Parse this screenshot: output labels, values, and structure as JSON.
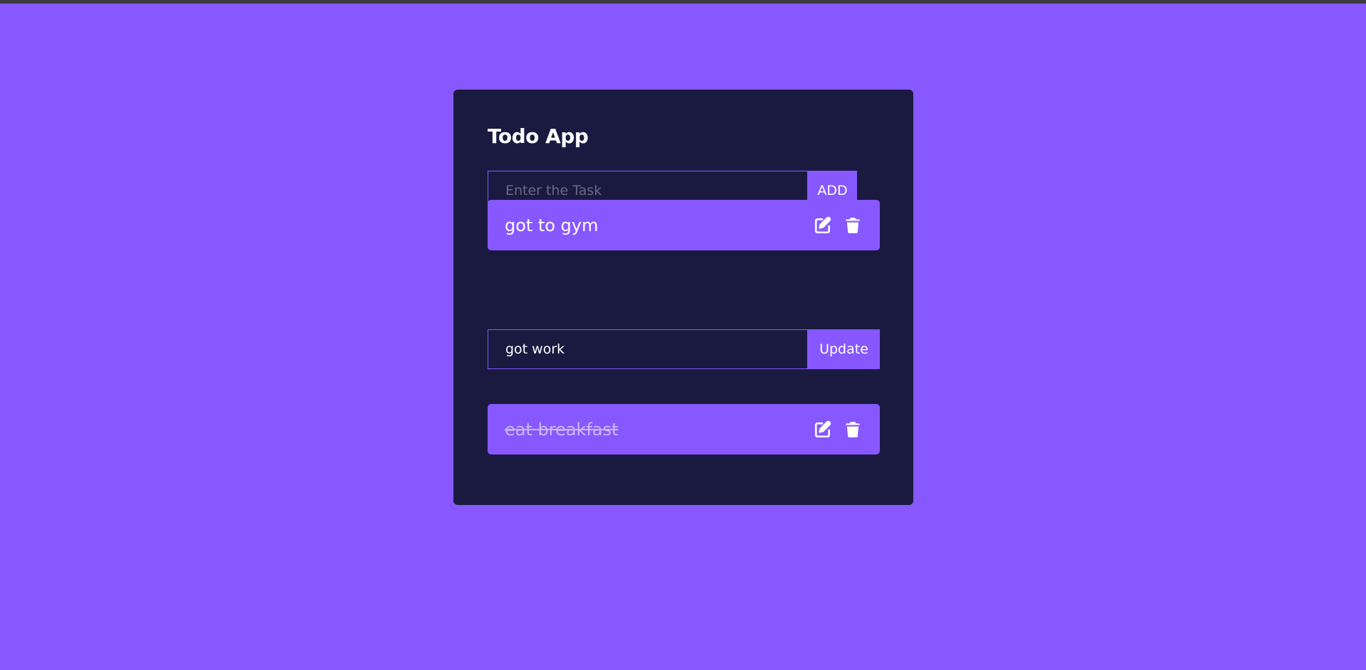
{
  "app": {
    "title": "Todo App"
  },
  "add_form": {
    "placeholder": "Enter the Task",
    "value": "",
    "button_label": "ADD"
  },
  "edit_form": {
    "value": "got work",
    "button_label": "Update"
  },
  "todos": [
    {
      "text": "got to gym",
      "completed": false
    },
    {
      "text": "eat breakfast",
      "completed": true
    }
  ],
  "icons": {
    "edit": "edit-icon",
    "delete": "trash-icon"
  },
  "colors": {
    "background": "#8758FF",
    "card": "#1A1A40",
    "accent": "#8758FF",
    "text": "#FFFFFF"
  }
}
